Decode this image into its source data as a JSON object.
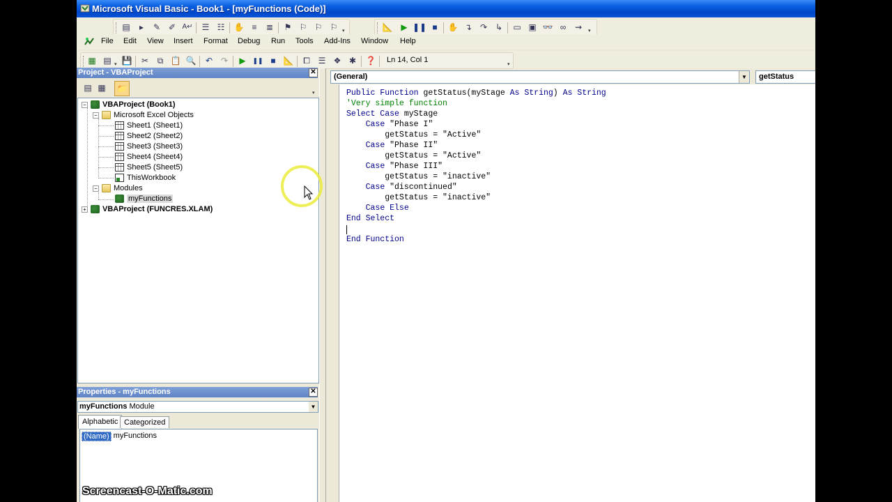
{
  "window": {
    "title": "Microsoft Visual Basic - Book1 - [myFunctions (Code)]"
  },
  "menu": [
    {
      "label": "File"
    },
    {
      "label": "Edit"
    },
    {
      "label": "View"
    },
    {
      "label": "Insert"
    },
    {
      "label": "Format"
    },
    {
      "label": "Debug"
    },
    {
      "label": "Run"
    },
    {
      "label": "Tools"
    },
    {
      "label": "Add-Ins"
    },
    {
      "label": "Window"
    },
    {
      "label": "Help"
    }
  ],
  "standard_toolbar": {
    "position_text": "Ln 14, Col 1"
  },
  "project_explorer": {
    "title": "Project - VBAProject",
    "tree": [
      {
        "label": "VBAProject (Book1)"
      },
      {
        "label": "Microsoft Excel Objects"
      },
      {
        "label": "Sheet1 (Sheet1)"
      },
      {
        "label": "Sheet2 (Sheet2)"
      },
      {
        "label": "Sheet3 (Sheet3)"
      },
      {
        "label": "Sheet4 (Sheet4)"
      },
      {
        "label": "Sheet5 (Sheet5)"
      },
      {
        "label": "ThisWorkbook"
      },
      {
        "label": "Modules"
      },
      {
        "label": "myFunctions"
      },
      {
        "label": "VBAProject (FUNCRES.XLAM)"
      }
    ]
  },
  "properties": {
    "title": "Properties - myFunctions",
    "object_name": "myFunctions",
    "object_type": "Module",
    "tabs": [
      "Alphabetic",
      "Categorized"
    ],
    "row": {
      "name": "(Name)",
      "value": "myFunctions"
    }
  },
  "code_window": {
    "object_combo": "(General)",
    "procedure_combo": "getStatus",
    "lines": [
      {
        "kw": "Public Function ",
        "text": "getStatus(myStage ",
        "kw2": "As String",
        "tail": ") ",
        "kw3": "As String"
      },
      {
        "comment": "'Very simple function"
      },
      {
        "kw": "Select Case ",
        "text": "myStage"
      },
      {
        "indent": "    ",
        "kw": "Case ",
        "text": "\"Phase I\""
      },
      {
        "indent": "        ",
        "text": "getStatus = \"Active\""
      },
      {
        "indent": "    ",
        "kw": "Case ",
        "text": "\"Phase II\""
      },
      {
        "indent": "        ",
        "text": "getStatus = \"Active\""
      },
      {
        "indent": "    ",
        "kw": "Case ",
        "text": "\"Phase III\""
      },
      {
        "indent": "        ",
        "text": "getStatus = \"inactive\""
      },
      {
        "indent": "    ",
        "kw": "Case ",
        "text": "\"discontinued\""
      },
      {
        "indent": "        ",
        "text": "getStatus = \"inactive\""
      },
      {
        "indent": "    ",
        "kw": "Case Else"
      },
      {
        "kw": "End Select"
      },
      {},
      {
        "kw": "End Function"
      }
    ]
  },
  "watermark": "Screencast-O-Matic.com"
}
